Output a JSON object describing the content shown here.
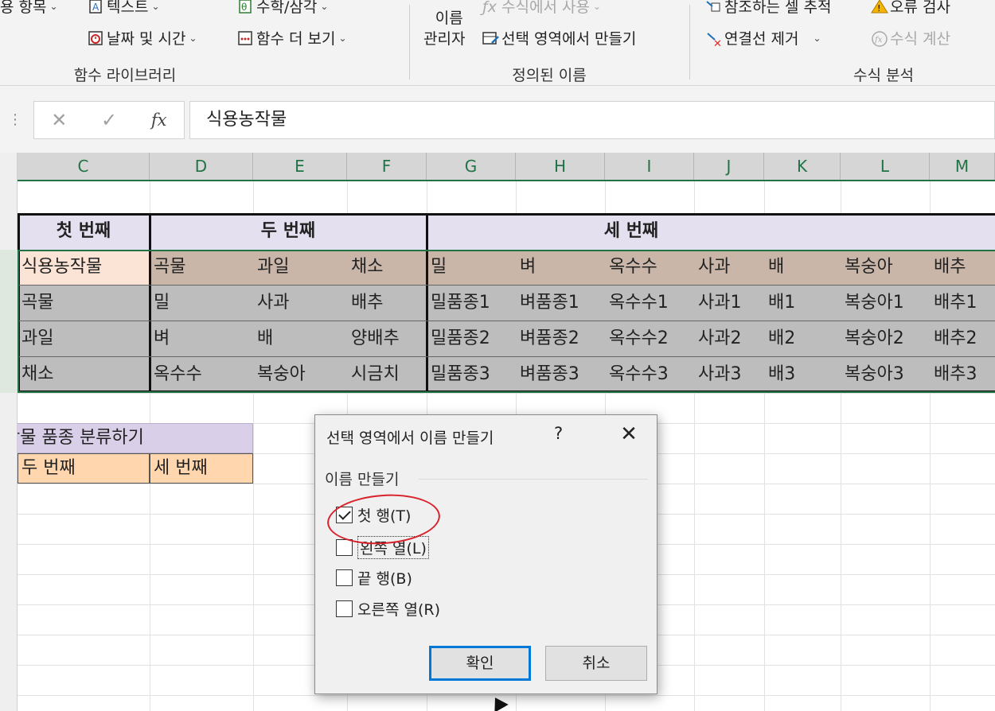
{
  "ribbon": {
    "function_library": {
      "recently_used": "용 항목",
      "text": "텍스트",
      "math_trig": "수학/삼각",
      "date_time": "날짜 및 시간",
      "more_functions": "함수 더 보기",
      "label": "함수 라이브러리"
    },
    "defined_names": {
      "name_manager_line1": "이름",
      "name_manager_line2": "관리자",
      "use_in_formula": "수식에서 사용",
      "create_from_selection": "선택 영역에서 만들기",
      "label": "정의된 이름"
    },
    "formula_auditing": {
      "trace_precedents": "참조하는 셀 추적",
      "error_checking": "오류 검사",
      "remove_arrows": "연결선 제거",
      "evaluate_formula": "수식 계산",
      "label": "수식 분석"
    }
  },
  "formula_bar": {
    "cancel": "✕",
    "enter": "✓",
    "fx": "fx",
    "value": "식용농작물"
  },
  "columns": [
    "C",
    "D",
    "E",
    "F",
    "G",
    "H",
    "I",
    "J",
    "K",
    "L",
    "M"
  ],
  "table": {
    "headers": [
      "첫 번째",
      "두 번째",
      "세 번째"
    ],
    "rows": [
      [
        "식용농작물",
        "곡물",
        "과일",
        "채소",
        "밀",
        "벼",
        "옥수수",
        "사과",
        "배",
        "복숭아",
        "배추"
      ],
      [
        "곡물",
        "밀",
        "사과",
        "배추",
        "밀품종1",
        "벼품종1",
        "옥수수1",
        "사과1",
        "배1",
        "복숭아1",
        "배추1"
      ],
      [
        "과일",
        "벼",
        "배",
        "양배추",
        "밀품종2",
        "벼품종2",
        "옥수수2",
        "사과2",
        "배2",
        "복숭아2",
        "배추2"
      ],
      [
        "채소",
        "옥수수",
        "복숭아",
        "시금치",
        "밀품종3",
        "벼품종3",
        "옥수수3",
        "사과3",
        "배3",
        "복숭아3",
        "배추3"
      ]
    ]
  },
  "lower": {
    "title": "작물 품종 분류하기",
    "sub_headers": [
      "두 번째",
      "세 번째"
    ]
  },
  "dialog": {
    "title": "선택 영역에서 이름 만들기",
    "help": "?",
    "close": "✕",
    "group": "이름 만들기",
    "options": [
      {
        "label": "첫 행(T)",
        "checked": true
      },
      {
        "label": "왼쪽 열(L)",
        "checked": false
      },
      {
        "label": "끝 행(B)",
        "checked": false
      },
      {
        "label": "오른쪽 열(R)",
        "checked": false
      }
    ],
    "ok": "확인",
    "cancel": "취소"
  }
}
